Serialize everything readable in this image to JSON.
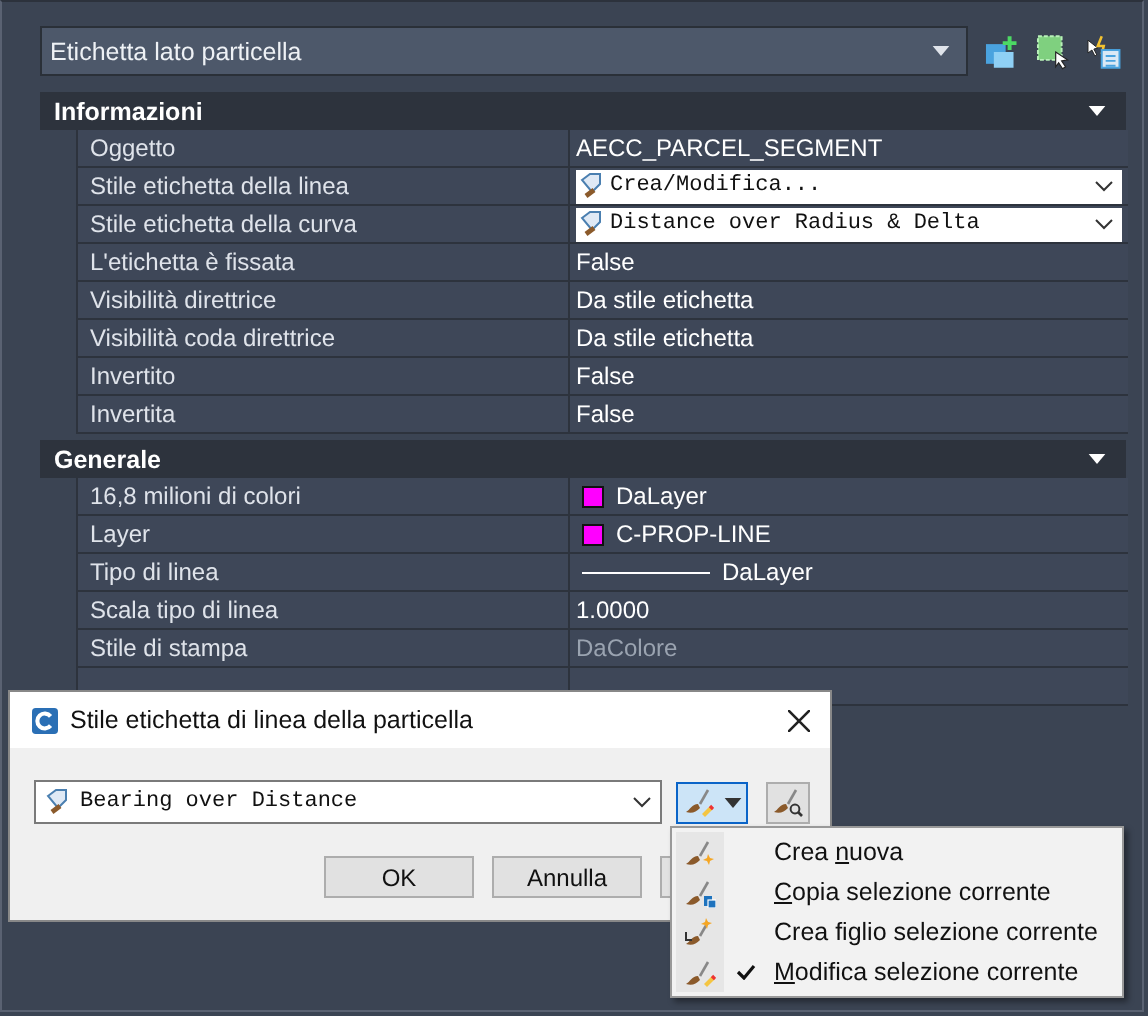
{
  "palette": {
    "selector": "Etichetta lato particella"
  },
  "sections": [
    {
      "title": "Informazioni",
      "expanded": true,
      "rows": [
        {
          "label": "Oggetto",
          "kind": "text",
          "value": "AECC_PARCEL_SEGMENT"
        },
        {
          "label": "Stile etichetta della linea",
          "kind": "combo",
          "value": "Crea/Modifica..."
        },
        {
          "label": "Stile etichetta della curva",
          "kind": "combo",
          "value": "Distance over Radius & Delta"
        },
        {
          "label": "L'etichetta è fissata",
          "kind": "text",
          "value": "False"
        },
        {
          "label": "Visibilità direttrice",
          "kind": "text",
          "value": "Da stile etichetta"
        },
        {
          "label": "Visibilità coda direttrice",
          "kind": "text",
          "value": "Da stile etichetta"
        },
        {
          "label": "Invertito",
          "kind": "text",
          "value": "False"
        },
        {
          "label": "Invertita",
          "kind": "text",
          "value": "False"
        }
      ]
    },
    {
      "title": "Generale",
      "expanded": true,
      "rows": [
        {
          "label": "16,8 milioni di colori",
          "kind": "swatch",
          "color": "#ff00ff",
          "value": "DaLayer"
        },
        {
          "label": "Layer",
          "kind": "swatch",
          "color": "#ff00ff",
          "value": "C-PROP-LINE"
        },
        {
          "label": "Tipo di linea",
          "kind": "linetype",
          "value": "DaLayer"
        },
        {
          "label": "Scala tipo di linea",
          "kind": "text",
          "value": "1.0000"
        },
        {
          "label": "Stile di stampa",
          "kind": "disabled",
          "value": "DaColore"
        }
      ]
    }
  ],
  "dialog": {
    "title": "Stile etichetta di linea della particella",
    "style": "Bearing over Distance",
    "buttons": [
      "OK",
      "Annulla"
    ]
  },
  "menu": [
    {
      "kind": "new",
      "pre": "Crea ",
      "key": "n",
      "post": "uova",
      "checked": false
    },
    {
      "kind": "copy",
      "key": "C",
      "post": "opia selezione corrente",
      "checked": false
    },
    {
      "kind": "child",
      "pre": "Crea fi",
      "key": "g",
      "post": "lio selezione corrente",
      "checked": false
    },
    {
      "kind": "edit",
      "key": "M",
      "post": "odifica selezione corrente",
      "checked": true
    }
  ]
}
